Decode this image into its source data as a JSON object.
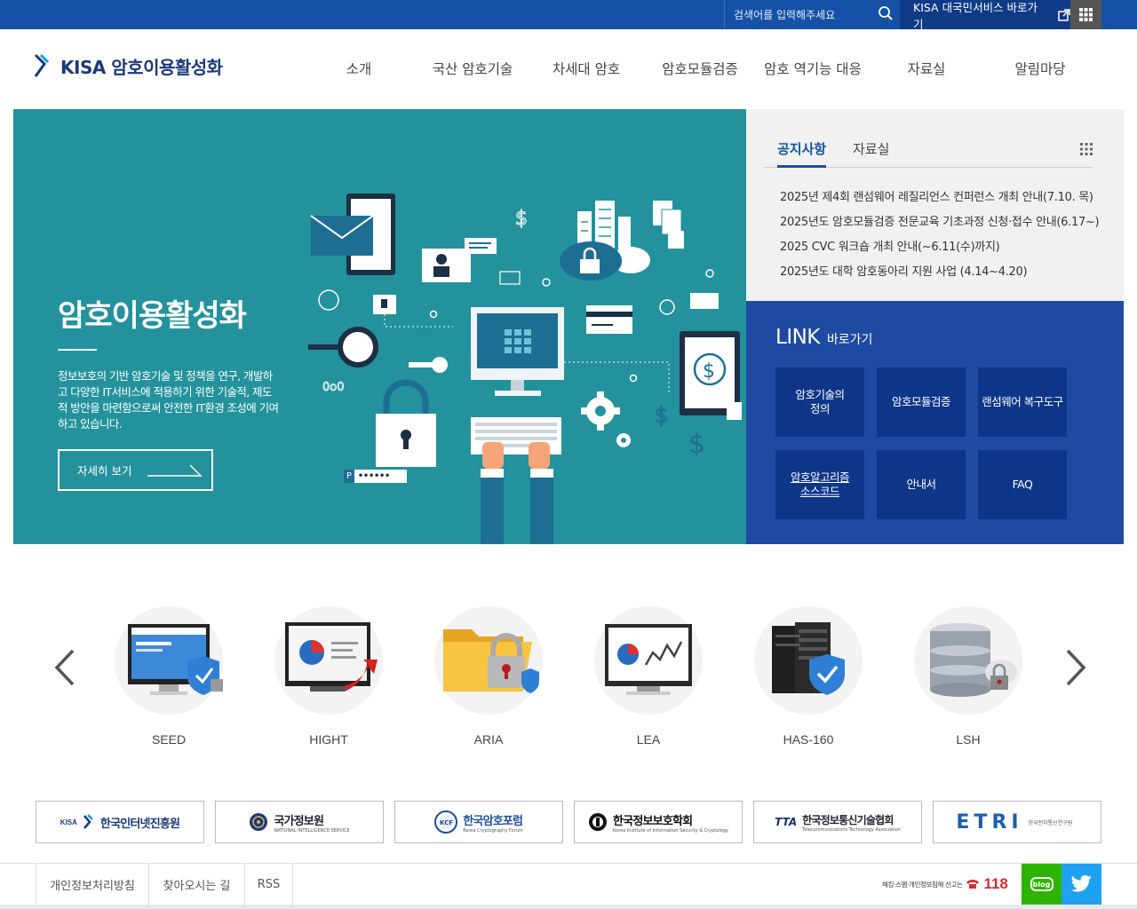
{
  "topbar": {
    "search_placeholder": "검색어를 입력해주세요",
    "kisa_link": "KISA 대국민서비스 바로가기"
  },
  "header": {
    "logo_text": "KISA 암호이용활성화",
    "nav": [
      "소개",
      "국산 암호기술",
      "차세대 암호",
      "암호모듈검증",
      "암호 역기능 대응",
      "자료실",
      "알림마당"
    ]
  },
  "hero": {
    "title": "암호이용활성화",
    "description": "정보보호의 기반 암호기술 및 정책을 연구, 개발하고 다양한 IT서비스에 적용하기 위한 기술적, 제도적 방안을 마련함으로써 안전한 IT환경 조성에 기여하고 있습니다.",
    "more_label": "자세히 보기",
    "password_letter": "P",
    "password_dots": "••••••"
  },
  "notice": {
    "tabs": [
      "공지사항",
      "자료실"
    ],
    "items": [
      "2025년 제4회 랜섬웨어 레질리언스 컨퍼런스 개최 안내(7.10. 목)",
      "2025년도 암호모듈검증 전문교육 기초과정 신청·접수 안내(6.17~)",
      "2025 CVC 워크숍 개최 안내(~6.11(수)까지)",
      "2025년도 대학 암호동아리 지원 사업 (4.14~4.20)"
    ]
  },
  "links": {
    "title_big": "LINK",
    "title_small": "바로가기",
    "buttons": [
      {
        "label": "암호기술의 정의"
      },
      {
        "label": "암호모듈검증"
      },
      {
        "label": "랜섬웨어 복구도구"
      },
      {
        "label": "암호알고리즘 소스코드"
      },
      {
        "label": "안내서"
      },
      {
        "label": "FAQ"
      }
    ]
  },
  "algorithms": [
    "SEED",
    "HIGHT",
    "ARIA",
    "LEA",
    "HAS-160",
    "LSH"
  ],
  "partners": [
    {
      "name": "한국인터넷진흥원",
      "prefix": "KISA",
      "sub": ""
    },
    {
      "name": "국가정보원",
      "prefix": "",
      "sub": "NATIONAL INTELLIGENCE SERVICE"
    },
    {
      "name": "한국암호포럼",
      "prefix": "",
      "sub": "Korea Cryptography Forum"
    },
    {
      "name": "한국정보보호학회",
      "prefix": "",
      "sub": "Korea Institute of Information Security & Cryptology"
    },
    {
      "name": "한국정보통신기술협회",
      "prefix": "TTA",
      "sub": "Telecommunications Technology Association"
    },
    {
      "name": "ETRI",
      "prefix": "",
      "sub": "한국전자통신연구원"
    }
  ],
  "footer": {
    "links": [
      "개인정보처리방침",
      "찾아오시는 길",
      "RSS"
    ],
    "report_text": "해킹·스팸·개인정보침해 신고는",
    "report_number": "118",
    "blog_label": "blog"
  },
  "colors": {
    "topbar": "#1651a8",
    "hero_bg": "#23929c",
    "links_bg": "#1e4aa1",
    "link_button": "#0d3688"
  }
}
